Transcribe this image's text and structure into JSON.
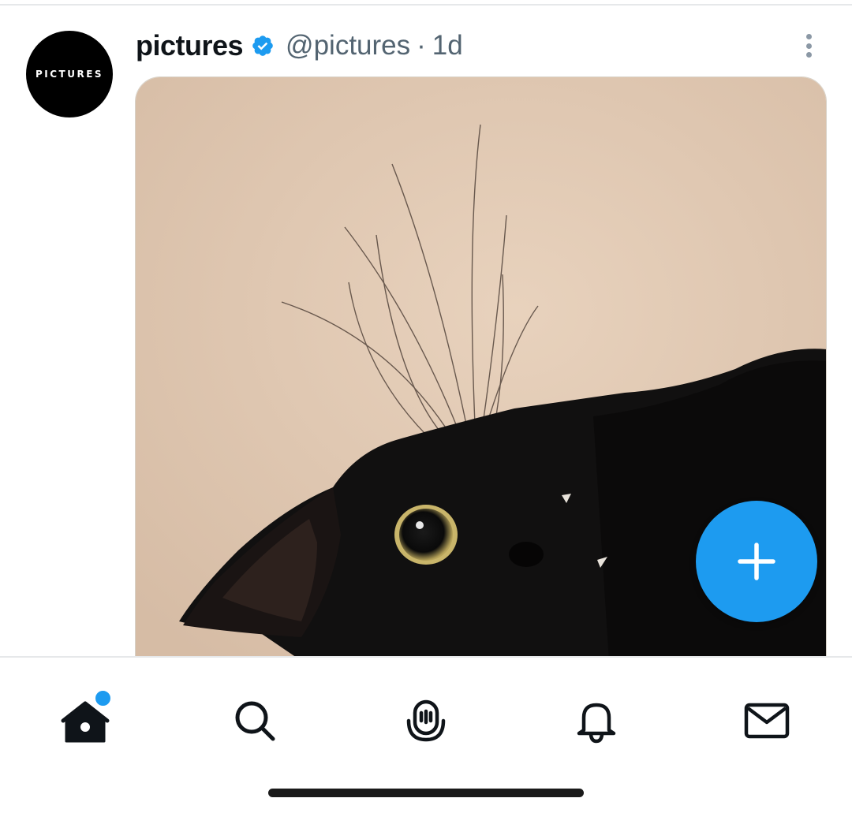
{
  "tweet": {
    "author": {
      "display_name": "pictures",
      "handle": "@pictures",
      "avatar_text": "PICTURES",
      "verified": true
    },
    "separator": "·",
    "time": "1d",
    "media": {
      "subject": "black cat"
    }
  },
  "compose_button": {
    "icon": "plus-icon"
  },
  "bottom_nav": {
    "items": [
      {
        "icon": "home-icon",
        "active": true,
        "has_unread_dot": true
      },
      {
        "icon": "search-icon",
        "active": false
      },
      {
        "icon": "spaces-icon",
        "active": false
      },
      {
        "icon": "bell-icon",
        "active": false
      },
      {
        "icon": "mail-icon",
        "active": false
      }
    ]
  },
  "colors": {
    "accent": "#1d9bf0",
    "text_primary": "#0f1419",
    "text_secondary": "#536471"
  }
}
